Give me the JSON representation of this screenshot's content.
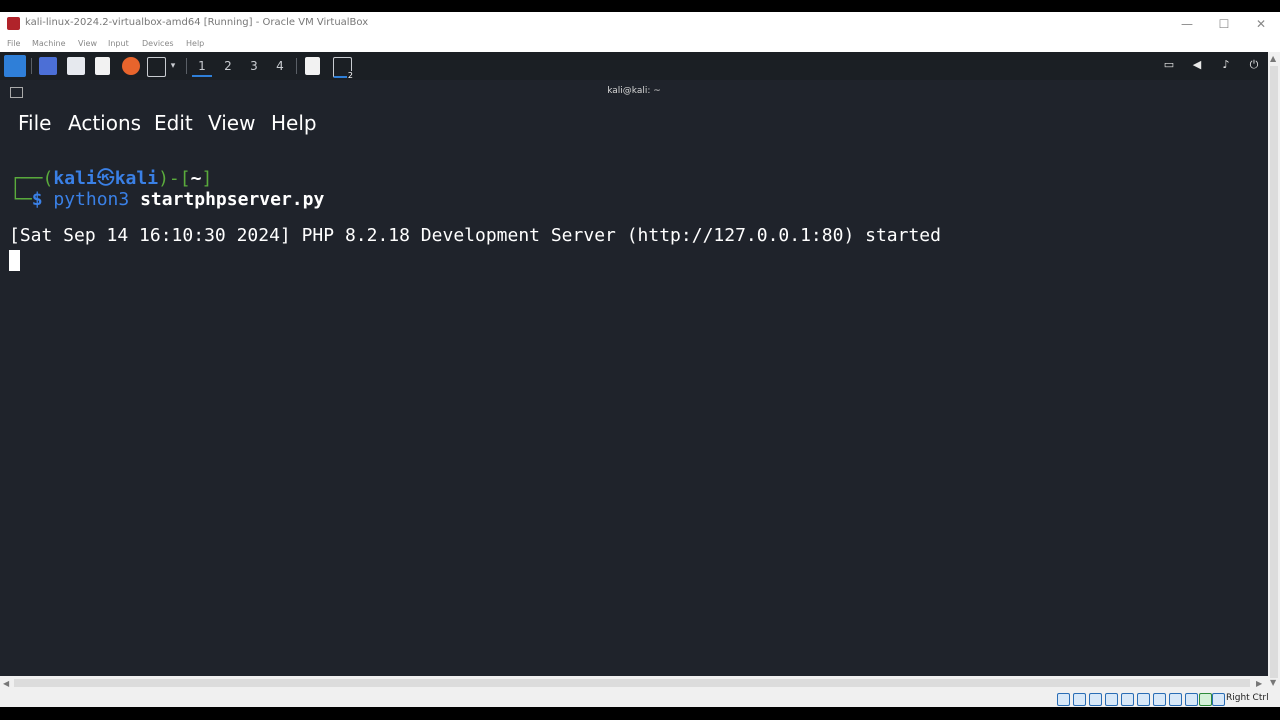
{
  "host_window": {
    "title": "kali-linux-2024.2-virtualbox-amd64 [Running] - Oracle VM VirtualBox",
    "minimize_glyph": "—",
    "maximize_glyph": "☐",
    "close_glyph": "✕",
    "menu": [
      "File",
      "Machine",
      "View",
      "Input",
      "Devices",
      "Help"
    ]
  },
  "panel": {
    "workspaces": [
      "1",
      "2",
      "3",
      "4"
    ],
    "active_workspace": "1",
    "terminal_badge": "2",
    "tray_icons": [
      "display-icon",
      "volume-icon",
      "bell-icon",
      "power-icon"
    ],
    "tray_glyphs": [
      "▭",
      "◀",
      "♪",
      "⏻"
    ]
  },
  "terminal": {
    "title": "kali@kali: ~",
    "menu": [
      "File",
      "Actions",
      "Edit",
      "View",
      "Help"
    ],
    "prompt": {
      "corner_top": "┌──(",
      "user": "kali",
      "at": "㉿",
      "host": "kali",
      "mid": ")-[",
      "dir": "~",
      "end": "]",
      "corner_bottom": "└─",
      "dollar": "$",
      "command": "python3",
      "argument": "startphpserver.py"
    },
    "output_line": "[Sat Sep 14 16:10:30 2024] PHP 8.2.18 Development Server (http://127.0.0.1:80) started"
  },
  "status_bar": {
    "host_key": "Right Ctrl"
  },
  "colors": {
    "terminal_bg": "#1f232b",
    "prompt_blue": "#3a80e6",
    "prompt_green": "#5aab3c",
    "accent": "#2f7fd8"
  }
}
